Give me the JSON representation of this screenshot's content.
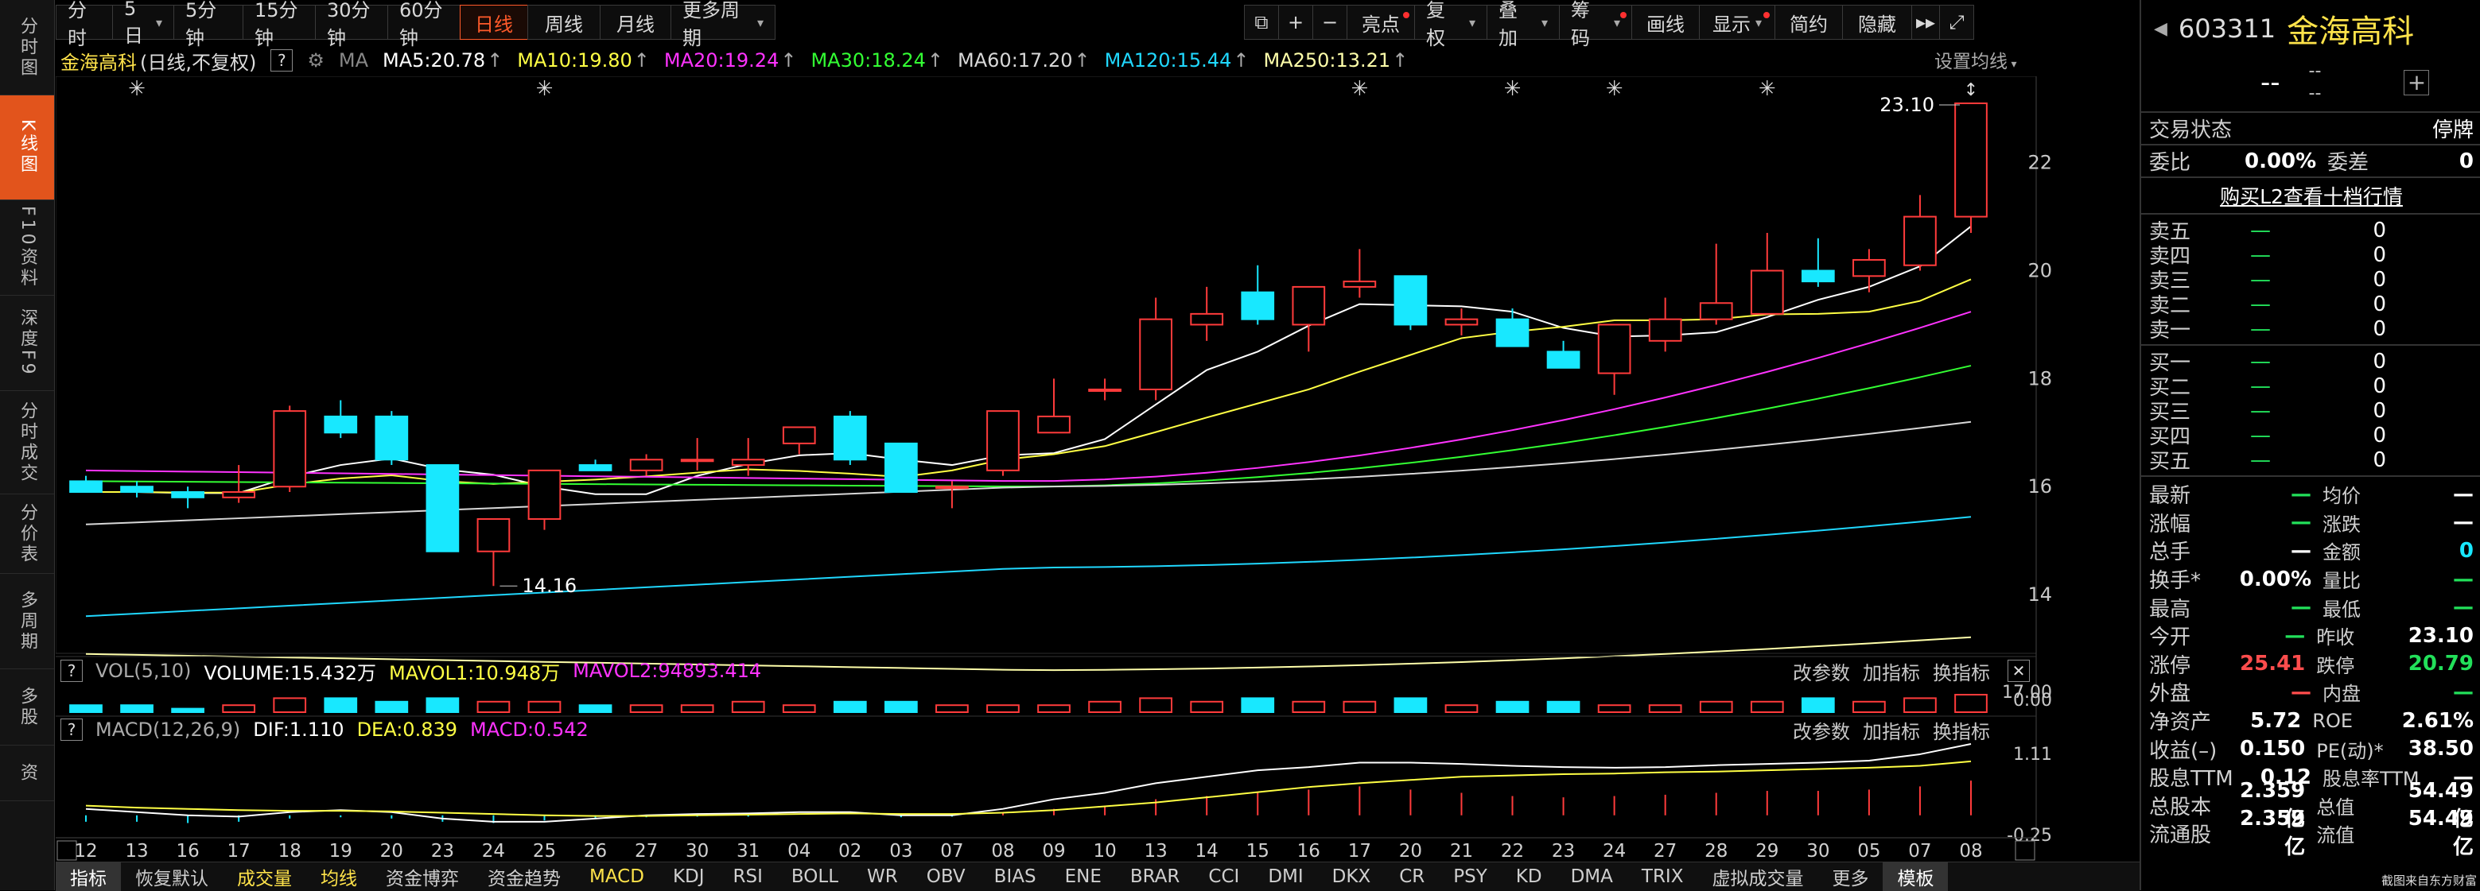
{
  "left_nav": [
    "分时图",
    "K线图",
    "F10资料",
    "深度F9",
    "分时成交",
    "分价表",
    "多周期",
    "多股",
    "资"
  ],
  "toolbar": {
    "periods": [
      "分时",
      "5日",
      "5分钟",
      "15分钟",
      "30分钟",
      "60分钟",
      "日线",
      "周线",
      "月线",
      "更多周期"
    ],
    "active_period": "日线",
    "tools": [
      "亮点",
      "复权",
      "叠加",
      "筹码",
      "画线",
      "显示",
      "简约",
      "隐藏"
    ]
  },
  "ma_line": {
    "stock": "金海高科",
    "mode": "(日线,不复权)",
    "ma_label": "MA",
    "items": [
      {
        "label": "MA5:20.78",
        "color": "#ffffff"
      },
      {
        "label": "MA10:19.80",
        "color": "#ffff44"
      },
      {
        "label": "MA20:19.24",
        "color": "#ff33ff"
      },
      {
        "label": "MA30:18.24",
        "color": "#33ff33"
      },
      {
        "label": "MA60:17.20",
        "color": "#d8d8d8"
      },
      {
        "label": "MA120:15.44",
        "color": "#20d8ff"
      },
      {
        "label": "MA250:13.21",
        "color": "#ffffaa"
      }
    ],
    "settings": "设置均线"
  },
  "vol_header": {
    "label": "VOL(5,10)",
    "volume": "VOLUME:15.432万",
    "mavol1": "MAVOL1:10.948万",
    "mavol2": "MAVOL2:94893.414",
    "btns": [
      "改参数",
      "加指标",
      "换指标"
    ]
  },
  "macd_header": {
    "label": "MACD(12,26,9)",
    "dif": "DIF:1.110",
    "dea": "DEA:0.839",
    "macd": "MACD:0.542",
    "btns": [
      "改参数",
      "加指标",
      "换指标"
    ]
  },
  "chart_data": {
    "type": "candlestick",
    "dates": [
      "12",
      "13",
      "16",
      "17",
      "18",
      "19",
      "20",
      "23",
      "24",
      "25",
      "26",
      "27",
      "30",
      "31",
      "04",
      "02",
      "03",
      "07",
      "08",
      "09",
      "10",
      "13",
      "14",
      "15",
      "16",
      "17",
      "20",
      "21",
      "22",
      "23",
      "24",
      "27",
      "28",
      "29",
      "30",
      "05",
      "07",
      "08"
    ],
    "ohlc": [
      [
        16.1,
        16.2,
        15.9,
        15.9
      ],
      [
        16.0,
        16.1,
        15.8,
        15.9
      ],
      [
        15.9,
        16.0,
        15.6,
        15.8
      ],
      [
        15.8,
        16.4,
        15.7,
        15.9
      ],
      [
        16.0,
        17.5,
        15.9,
        17.4
      ],
      [
        17.3,
        17.6,
        16.9,
        17.0
      ],
      [
        17.3,
        17.4,
        16.4,
        16.5
      ],
      [
        16.4,
        16.4,
        14.8,
        14.8
      ],
      [
        14.8,
        15.4,
        14.16,
        15.4
      ],
      [
        15.4,
        16.3,
        15.2,
        16.3
      ],
      [
        16.4,
        16.5,
        16.3,
        16.3
      ],
      [
        16.3,
        16.6,
        16.2,
        16.5
      ],
      [
        16.5,
        16.9,
        16.3,
        16.5
      ],
      [
        16.4,
        16.9,
        16.2,
        16.5
      ],
      [
        16.8,
        17.1,
        16.6,
        17.1
      ],
      [
        17.3,
        17.4,
        16.4,
        16.5
      ],
      [
        16.8,
        16.8,
        15.9,
        15.9
      ],
      [
        16.0,
        16.1,
        15.6,
        16.0
      ],
      [
        16.3,
        17.4,
        16.2,
        17.4
      ],
      [
        17.0,
        18.0,
        17.0,
        17.3
      ],
      [
        17.8,
        18.0,
        17.6,
        17.8
      ],
      [
        17.8,
        19.5,
        17.6,
        19.1
      ],
      [
        19.0,
        19.7,
        18.7,
        19.2
      ],
      [
        19.6,
        20.1,
        19.0,
        19.1
      ],
      [
        19.0,
        19.7,
        18.5,
        19.7
      ],
      [
        19.7,
        20.4,
        19.5,
        19.8
      ],
      [
        19.9,
        19.9,
        18.9,
        19.0
      ],
      [
        19.0,
        19.3,
        18.8,
        19.1
      ],
      [
        19.1,
        19.3,
        18.6,
        18.6
      ],
      [
        18.5,
        18.7,
        18.2,
        18.2
      ],
      [
        18.1,
        19.0,
        17.7,
        19.0
      ],
      [
        18.7,
        19.5,
        18.5,
        19.1
      ],
      [
        19.1,
        20.5,
        19.0,
        19.4
      ],
      [
        19.2,
        20.7,
        19.2,
        20.0
      ],
      [
        20.0,
        20.6,
        19.7,
        19.8
      ],
      [
        19.9,
        20.4,
        19.6,
        20.2
      ],
      [
        20.1,
        21.4,
        20.0,
        21.0
      ],
      [
        21.0,
        23.1,
        20.7,
        23.1
      ]
    ],
    "price_ticks": [
      22.0,
      20.0,
      18.0,
      16.0,
      14.0
    ],
    "ylim": [
      13.0,
      23.6
    ],
    "annotations": {
      "high": "23.10",
      "low": "14.16"
    },
    "ma_series": [
      {
        "name": "MA5",
        "color": "#ffffff",
        "start": 16.0,
        "mid": 16.2,
        "end": 20.78
      },
      {
        "name": "MA10",
        "color": "#ffff44",
        "start": 16.2,
        "mid": 16.1,
        "end": 19.8
      },
      {
        "name": "MA20",
        "color": "#ff33ff",
        "start": 16.3,
        "mid": 16.1,
        "end": 19.24
      },
      {
        "name": "MA30",
        "color": "#33ff33",
        "start": 16.1,
        "mid": 16.0,
        "end": 18.24
      },
      {
        "name": "MA60",
        "color": "#d8d8d8",
        "start": 15.3,
        "mid": 16.0,
        "end": 17.2
      },
      {
        "name": "MA120",
        "color": "#20d8ff",
        "start": 13.6,
        "mid": 14.5,
        "end": 15.44
      },
      {
        "name": "MA250",
        "color": "#ffffaa",
        "start": 12.9,
        "mid": 12.6,
        "end": 13.21
      }
    ],
    "volume": [
      2,
      2,
      1,
      2,
      4,
      4,
      3,
      4,
      3,
      3,
      2,
      2,
      2,
      3,
      2,
      3,
      3,
      2,
      2,
      2,
      3,
      4,
      3,
      4,
      3,
      3,
      4,
      2,
      3,
      3,
      2,
      2,
      3,
      3,
      4,
      3,
      4,
      5
    ],
    "vol_ticks": [
      "17.00",
      "0.00"
    ],
    "macd_ticks": [
      "1.11",
      "-0.25"
    ],
    "macd_bars": [
      -0.1,
      -0.1,
      -0.12,
      -0.1,
      -0.05,
      -0.03,
      -0.05,
      -0.1,
      -0.12,
      -0.08,
      -0.05,
      -0.03,
      -0.02,
      -0.02,
      0,
      0,
      -0.03,
      -0.02,
      0.05,
      0.1,
      0.15,
      0.25,
      0.3,
      0.35,
      0.4,
      0.45,
      0.4,
      0.35,
      0.3,
      0.28,
      0.3,
      0.32,
      0.35,
      0.38,
      0.38,
      0.4,
      0.45,
      0.54
    ],
    "dif": [
      0.1,
      0.05,
      0,
      -0.02,
      0.05,
      0.08,
      0.05,
      -0.05,
      -0.1,
      -0.1,
      -0.05,
      0,
      0.02,
      0.03,
      0.05,
      0.05,
      0,
      0,
      0.1,
      0.25,
      0.35,
      0.5,
      0.6,
      0.7,
      0.75,
      0.82,
      0.82,
      0.8,
      0.77,
      0.75,
      0.74,
      0.75,
      0.78,
      0.8,
      0.82,
      0.85,
      0.95,
      1.11
    ],
    "dea": [
      0.15,
      0.12,
      0.1,
      0.08,
      0.07,
      0.07,
      0.06,
      0.04,
      0.02,
      0,
      -0.01,
      -0.01,
      0,
      0.01,
      0.02,
      0.03,
      0.02,
      0.02,
      0.04,
      0.08,
      0.14,
      0.2,
      0.28,
      0.36,
      0.44,
      0.5,
      0.55,
      0.6,
      0.62,
      0.64,
      0.65,
      0.67,
      0.68,
      0.7,
      0.72,
      0.74,
      0.77,
      0.84
    ]
  },
  "right_panel": {
    "code": "603311",
    "name": "金海高科",
    "price": "--",
    "chg1": "--",
    "chg2": "--",
    "state_label": "交易状态",
    "state_value": "停牌",
    "weibi_label": "委比",
    "weibi_value": "0.00%",
    "weicha_label": "委差",
    "weicha_value": "0",
    "l2_link": "购买L2查看十档行情",
    "asks": [
      {
        "label": "卖五",
        "price": "—",
        "vol": "0"
      },
      {
        "label": "卖四",
        "price": "—",
        "vol": "0"
      },
      {
        "label": "卖三",
        "price": "—",
        "vol": "0"
      },
      {
        "label": "卖二",
        "price": "—",
        "vol": "0"
      },
      {
        "label": "卖一",
        "price": "—",
        "vol": "0"
      }
    ],
    "bids": [
      {
        "label": "买一",
        "price": "—",
        "vol": "0"
      },
      {
        "label": "买二",
        "price": "—",
        "vol": "0"
      },
      {
        "label": "买三",
        "price": "—",
        "vol": "0"
      },
      {
        "label": "买四",
        "price": "—",
        "vol": "0"
      },
      {
        "label": "买五",
        "price": "—",
        "vol": "0"
      }
    ],
    "stats": [
      {
        "l1": "最新",
        "v1": "—",
        "c1": "green",
        "l2": "均价",
        "v2": "—",
        "c2": "white"
      },
      {
        "l1": "涨幅",
        "v1": "—",
        "c1": "green",
        "l2": "涨跌",
        "v2": "—",
        "c2": "white"
      },
      {
        "l1": "总手",
        "v1": "—",
        "c1": "white",
        "l2": "金额",
        "v2": "0",
        "c2": "cyan"
      },
      {
        "l1": "换手*",
        "v1": "0.00%",
        "c1": "white",
        "l2": "量比",
        "v2": "—",
        "c2": "green"
      },
      {
        "l1": "最高",
        "v1": "—",
        "c1": "green",
        "l2": "最低",
        "v2": "—",
        "c2": "green"
      },
      {
        "l1": "今开",
        "v1": "—",
        "c1": "green",
        "l2": "昨收",
        "v2": "23.10",
        "c2": "white"
      },
      {
        "l1": "涨停",
        "v1": "25.41",
        "c1": "red",
        "l2": "跌停",
        "v2": "20.79",
        "c2": "green"
      },
      {
        "l1": "外盘",
        "v1": "—",
        "c1": "red",
        "l2": "内盘",
        "v2": "—",
        "c2": "green"
      },
      {
        "l1": "净资产",
        "v1": "5.72",
        "c1": "white",
        "l2": "ROE",
        "v2": "2.61%",
        "c2": "white"
      },
      {
        "l1": "收益(–)",
        "v1": "0.150",
        "c1": "white",
        "l2": "PE(动)*",
        "v2": "38.50",
        "c2": "white"
      },
      {
        "l1": "股息TTM",
        "v1": "0.12",
        "c1": "white",
        "l2": "股息率TTM",
        "v2": "—",
        "c2": "white"
      },
      {
        "l1": "总股本",
        "v1": "2.359亿",
        "c1": "white",
        "l2": "总值",
        "v2": "54.49亿",
        "c2": "white"
      },
      {
        "l1": "流通股",
        "v1": "2.359亿",
        "c1": "white",
        "l2": "流值",
        "v2": "54.49亿",
        "c2": "white"
      }
    ],
    "footer": "截图来自东方财富"
  },
  "bottom_tabs": [
    {
      "label": "指标",
      "style": "sel"
    },
    {
      "label": "恢复默认",
      "style": ""
    },
    {
      "label": "成交量",
      "style": "hl"
    },
    {
      "label": "均线",
      "style": "hl"
    },
    {
      "label": "资金博弈",
      "style": ""
    },
    {
      "label": "资金趋势",
      "style": ""
    },
    {
      "label": "MACD",
      "style": "hl"
    },
    {
      "label": "KDJ",
      "style": ""
    },
    {
      "label": "RSI",
      "style": ""
    },
    {
      "label": "BOLL",
      "style": ""
    },
    {
      "label": "WR",
      "style": ""
    },
    {
      "label": "OBV",
      "style": ""
    },
    {
      "label": "BIAS",
      "style": ""
    },
    {
      "label": "ENE",
      "style": ""
    },
    {
      "label": "BRAR",
      "style": ""
    },
    {
      "label": "CCI",
      "style": ""
    },
    {
      "label": "DMI",
      "style": ""
    },
    {
      "label": "DKX",
      "style": ""
    },
    {
      "label": "CR",
      "style": ""
    },
    {
      "label": "PSY",
      "style": ""
    },
    {
      "label": "KD",
      "style": ""
    },
    {
      "label": "DMA",
      "style": ""
    },
    {
      "label": "TRIX",
      "style": ""
    },
    {
      "label": "虚拟成交量",
      "style": ""
    },
    {
      "label": "更多",
      "style": ""
    },
    {
      "label": "模板",
      "style": "sel"
    }
  ]
}
